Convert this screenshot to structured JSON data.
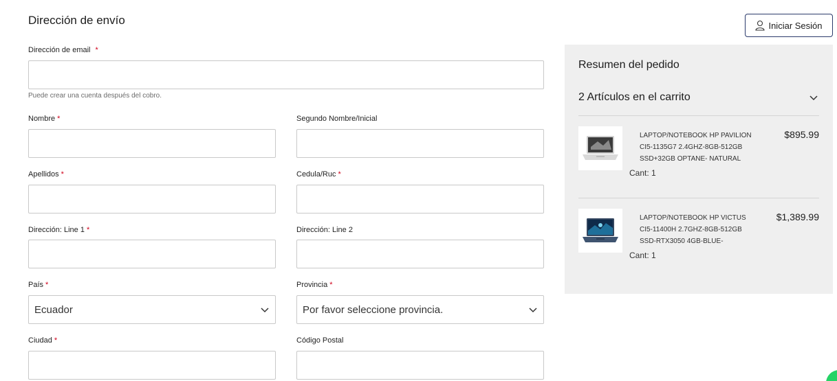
{
  "shipping": {
    "title": "Dirección de envío",
    "email_label": "Dirección de email",
    "email_hint": "Puede crear una cuenta después del cobro.",
    "first_name_label": "Nombre",
    "middle_name_label": "Segundo Nombre/Inicial",
    "last_name_label": "Apellidos",
    "id_label": "Cedula/Ruc",
    "address1_label": "Dirección: Line 1",
    "address2_label": "Dirección: Line 2",
    "country_label": "País",
    "country_value": "Ecuador",
    "province_label": "Provincia",
    "province_value": "Por favor seleccione provincia.",
    "city_label": "Ciudad",
    "postal_label": "Código Postal",
    "required_mark": "*"
  },
  "header": {
    "login_label": "Iniciar Sesión"
  },
  "summary": {
    "title": "Resumen del pedido",
    "cart_count_label": "2 Artículos en el carrito",
    "items": [
      {
        "name_lines": [
          "LAPTOP/NOTEBOOK HP PAVILION",
          "CI5-1135G7 2.4GHZ-8GB-512GB",
          "SSD+32GB OPTANE- NATURAL"
        ],
        "price": "$895.99",
        "qty": "Cant: 1",
        "image_icon": "laptop-silver-icon"
      },
      {
        "name_lines": [
          "LAPTOP/NOTEBOOK HP VICTUS",
          "CI5-11400H 2.7GHZ-8GB-512GB",
          "SSD-RTX3050 4GB-BLUE-"
        ],
        "price": "$1,389.99",
        "qty": "Cant: 1",
        "image_icon": "laptop-blue-icon"
      }
    ]
  },
  "colors": {
    "required": "#d0021b",
    "summary_bg": "#efefef",
    "login_border": "#2a3a6b",
    "chat_badge": "#25d366"
  }
}
